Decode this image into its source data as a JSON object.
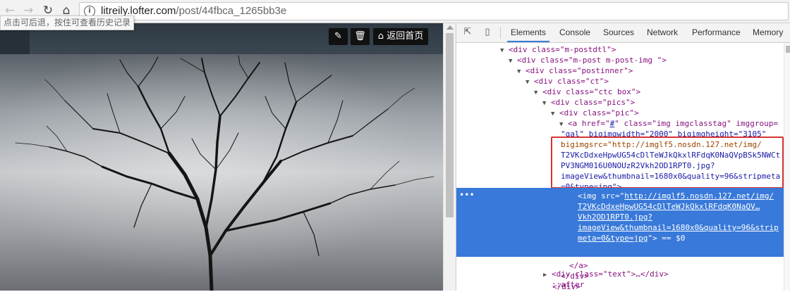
{
  "browser": {
    "back_icon": "back-arrow-icon",
    "forward_icon": "forward-arrow-icon",
    "reload_icon": "reload-icon",
    "home_icon": "home-icon",
    "url_host": "litreily.lofter.com",
    "url_path": "/post/44fbca_1265bb3e",
    "tooltip": "点击可后退，按住可查看历史记录"
  },
  "page": {
    "edit_icon": "pencil-icon",
    "delete_icon": "trash-icon",
    "home_button_label": "返回首页"
  },
  "devtools": {
    "tabs": [
      "Elements",
      "Console",
      "Sources",
      "Network",
      "Performance",
      "Memory"
    ],
    "selected_tab": "Elements",
    "lines": [
      "<div class=\"m-postdtl\">",
      "<div class=\"m-post m-post-img   \">",
      "<div class=\"postinner\">",
      "<div class=\"ct\">",
      "<div class=\"ctc box\">",
      "<div class=\"pics\">",
      "<div class=\"pic\">"
    ],
    "a_line1_pre": "<a href=\"",
    "a_href": "#",
    "a_line1_post": "\" class=\"img imgclasstag\" imggroup=",
    "a_line2": "\"gal\" bigimgwidth=\"2000\" bigimgheight=\"3105\"",
    "bigimgsrc_lines": [
      "bigimgsrc=\"http://imglf5.nosdn.127.net/img/",
      "T2VKcDdxeHpwUG54cDlTeWJkQkxlRFdqK0NaQVpBSk5NWCt",
      "PV3NGM016U0NOUzR2Vkh2OD1RPT0.jpg?",
      "imageView&thumbnail=1680x0&quality=96&stripmeta",
      "=0&type=jpg\">"
    ],
    "img_lines": [
      "http://imglf5.nosdn.127.net/img/",
      "T2VKcDdxeHpwUG54cDlTeWJkQkxlRFdqK0NaQV…",
      "Vkh2OD1RPT0.jpg?",
      "imageView&thumbnail=1680x0&quality=96&strip",
      "meta=0&type=jpg"
    ],
    "img_prefix": "<img src=\"",
    "img_suffix": "\"> == $0",
    "close_a": "</a>",
    "close_div1": "</div>",
    "close_div2": "</div>",
    "text_div": "<div class=\"text\">…</div>",
    "after": "::after",
    "dots": "•••"
  },
  "colors": {
    "highlight": "#3879d9",
    "red_box": "#d83434",
    "tag": "#881280",
    "attr": "#994500",
    "value": "#1a1aa6"
  }
}
